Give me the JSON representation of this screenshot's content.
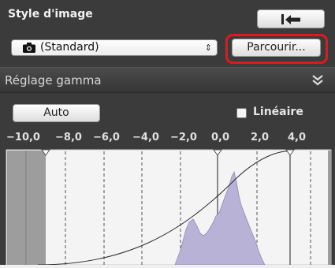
{
  "image_style": {
    "title": "Style d'image",
    "selected_style": "(Standard)",
    "select_arrows": "⇕",
    "browse_label": "Parcourir..."
  },
  "gamma": {
    "title": "Réglage gamma",
    "auto_label": "Auto",
    "linear_label": "Linéaire",
    "linear_checked": false,
    "axis_labels": [
      "−10,0",
      "−8,0",
      "−6,0",
      "−4,0",
      "−2,0",
      "0,0",
      "2,0",
      "4,0"
    ]
  },
  "icons": {
    "undo": "undo-arrow-icon",
    "camera": "camera-icon",
    "expand": "double-chevron-down-icon"
  },
  "colors": {
    "panel_bg": "#3b3b3b",
    "graph_bg": "#f4f4f4",
    "histogram": "#b8b3d6",
    "highlight": "#e0191f"
  }
}
